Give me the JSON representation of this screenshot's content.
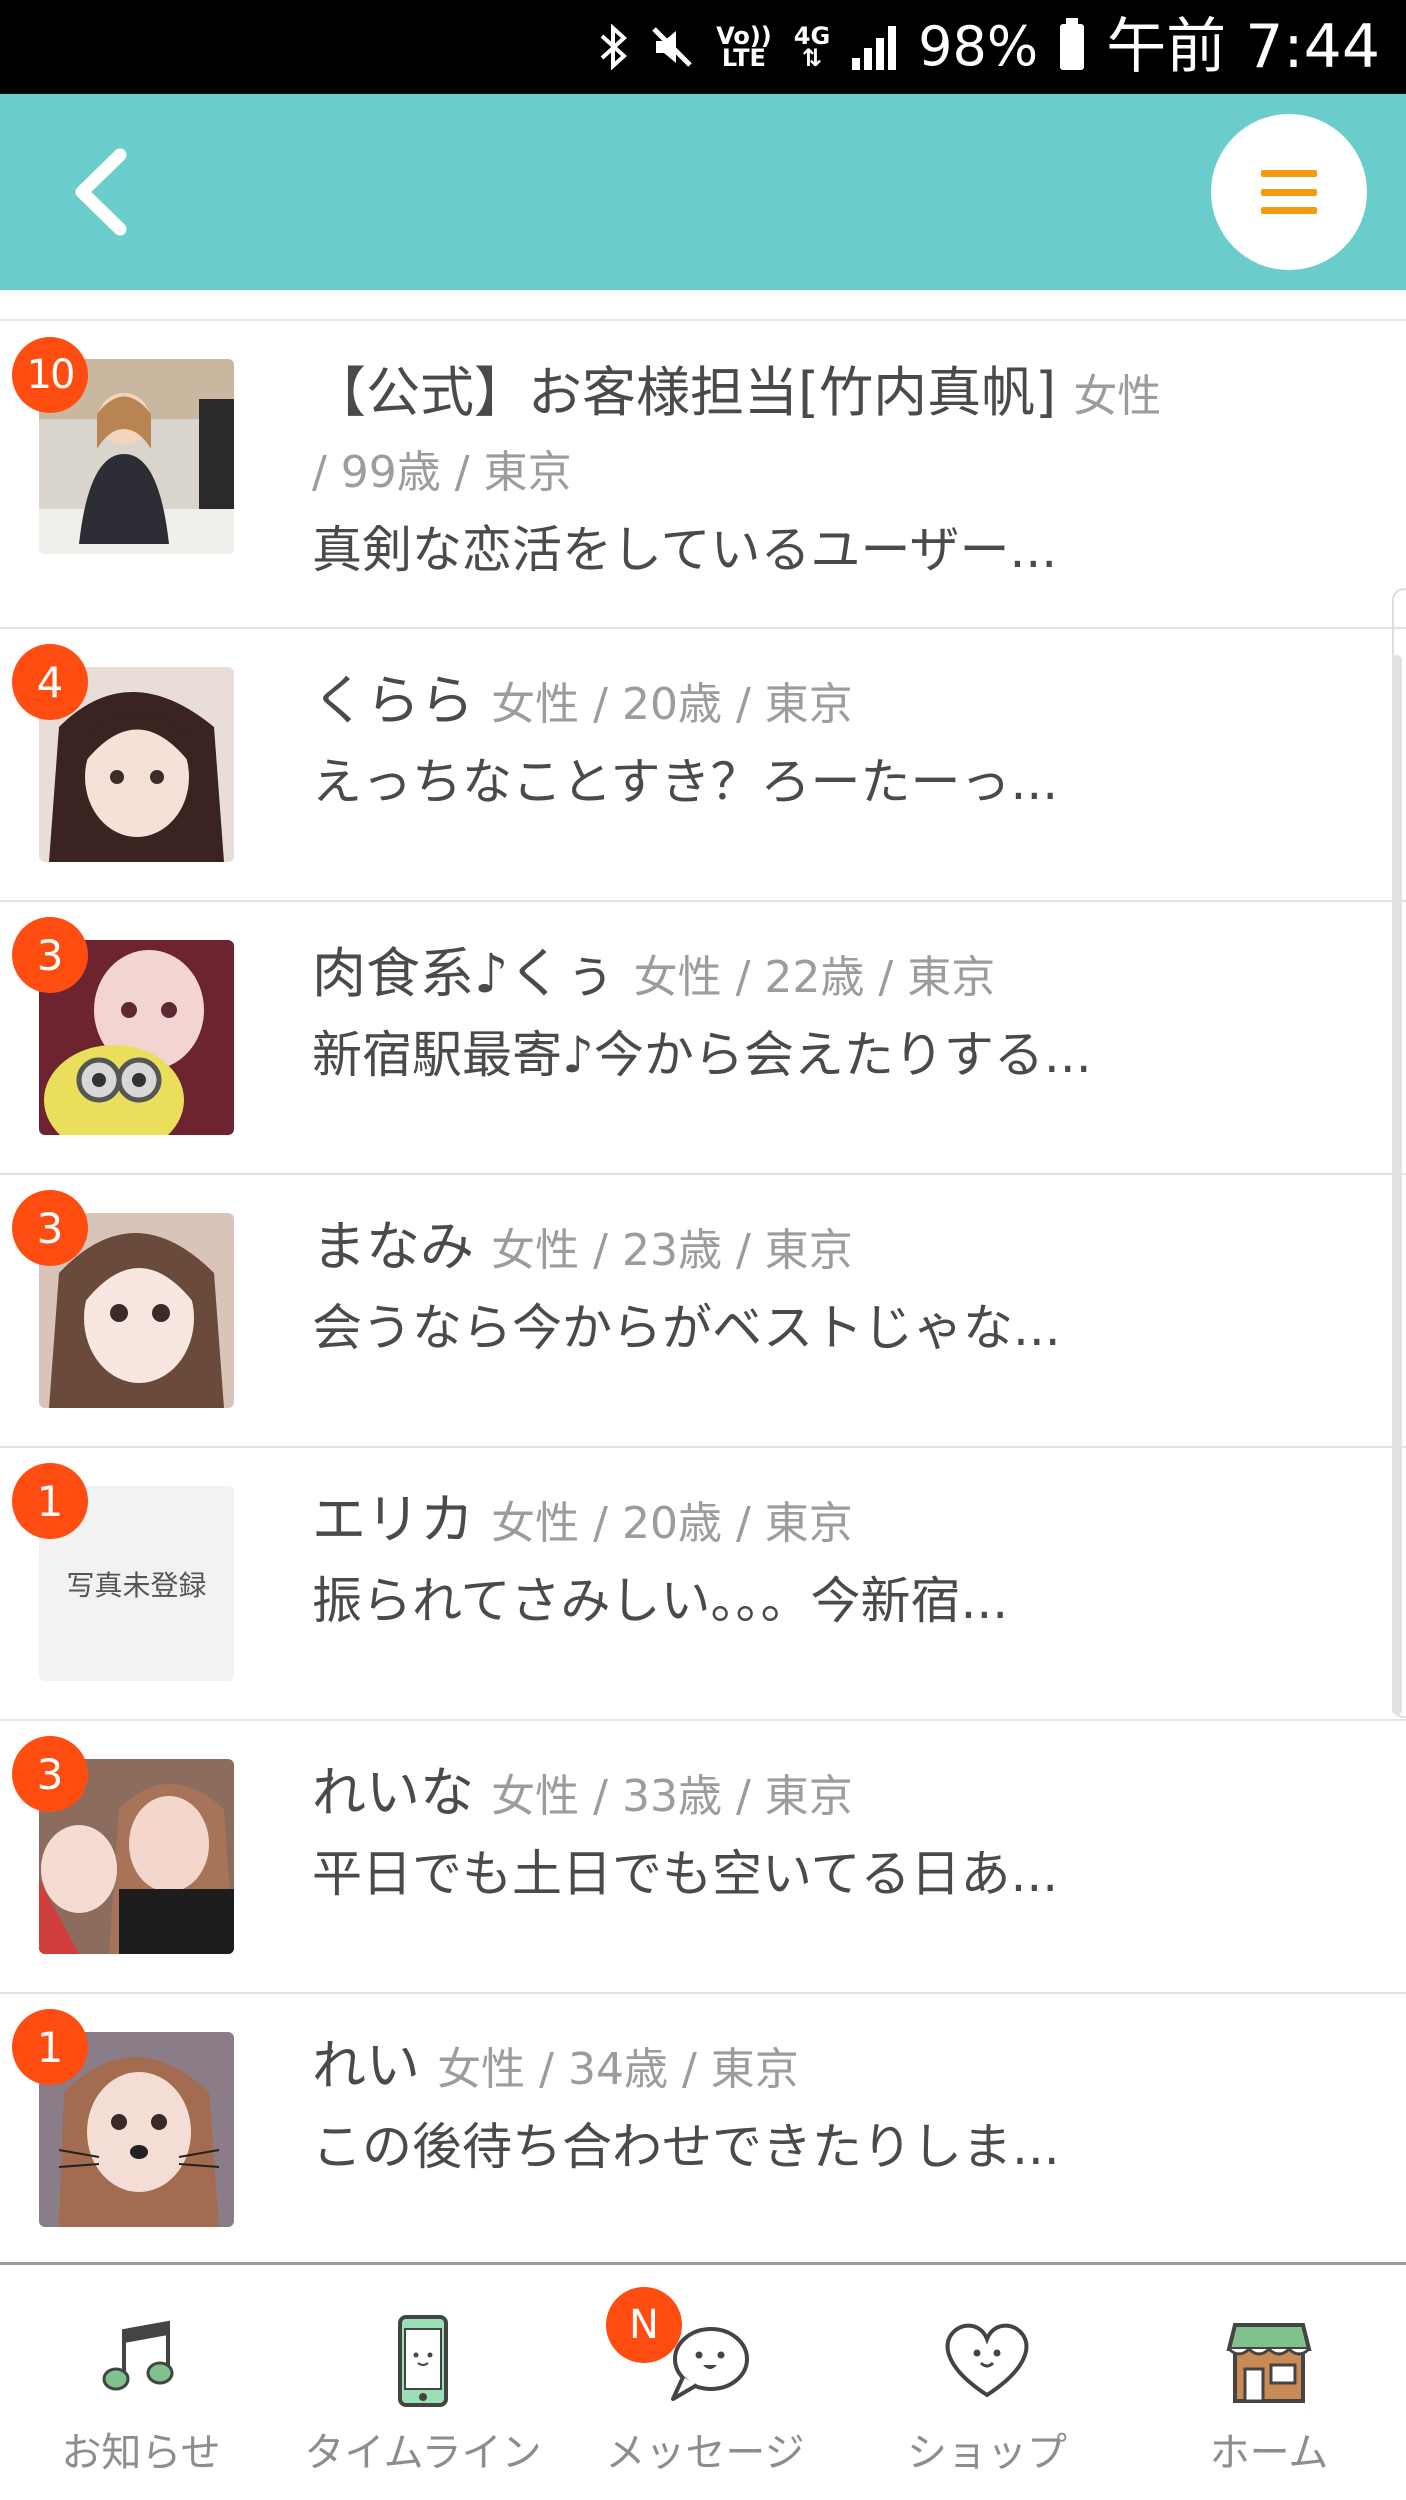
{
  "status_bar": {
    "bluetooth_icon": "bluetooth-icon",
    "mute_icon": "mute-icon",
    "volte": [
      "Vo))",
      "LTE"
    ],
    "network": "4G",
    "battery_percent": "98%",
    "time": "午前 7:44"
  },
  "header": {
    "back_icon": "chevron-left-icon",
    "menu_icon": "hamburger-menu-icon",
    "accent_color": "#6bcdcb",
    "menu_color": "#f39c12"
  },
  "messages": [
    {
      "name": "【公式】お客様担当[竹内真帆]",
      "meta_a": "女性",
      "meta_b": "/ 99歳 / 東京",
      "preview": "真剣な恋活をしているユーザー...",
      "unread": "10",
      "photo": true
    },
    {
      "name": "くらら",
      "meta": "女性 / 20歳 / 東京",
      "preview": "えっちなことすき？ろーたーっ...",
      "unread": "4",
      "photo": true
    },
    {
      "name": "肉食系♪くぅ",
      "meta": "女性 / 22歳 / 東京",
      "preview": "新宿駅最寄♪今から会えたりする...",
      "unread": "3",
      "photo": true
    },
    {
      "name": "まなみ",
      "meta": "女性 / 23歳 / 東京",
      "preview": "会うなら今からがベストじゃな...",
      "unread": "3",
      "photo": true
    },
    {
      "name": "エリカ",
      "meta": "女性 / 20歳 / 東京",
      "preview": "振られてさみしい。。。今新宿...",
      "unread": "1",
      "photo": false,
      "no_photo_text": "写真未登録"
    },
    {
      "name": "れいな",
      "meta": "女性 / 33歳 / 東京",
      "preview": "平日でも土日でも空いてる日あ...",
      "unread": "3",
      "photo": true
    },
    {
      "name": "れい",
      "meta": "女性 / 34歳 / 東京",
      "preview": "この後待ち合わせできたりしま...",
      "unread": "1",
      "photo": true
    }
  ],
  "badge_color": "#ff4d12",
  "bottom_nav": [
    {
      "label": "お知らせ",
      "icon": "music-note-icon"
    },
    {
      "label": "タイムライン",
      "icon": "smartphone-icon"
    },
    {
      "label": "メッセージ",
      "icon": "chat-bubble-icon",
      "badge": "N"
    },
    {
      "label": "ショップ",
      "icon": "heart-icon"
    },
    {
      "label": "ホーム",
      "icon": "shop-front-icon"
    }
  ]
}
